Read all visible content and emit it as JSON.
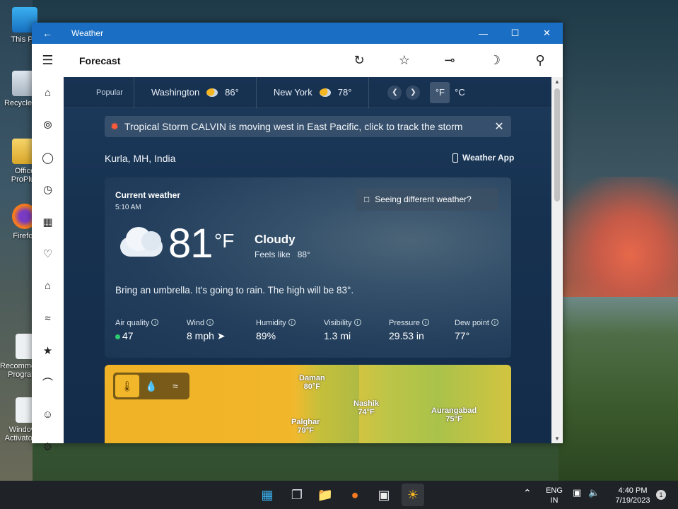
{
  "desktop": {
    "icons": [
      {
        "label": "This PC"
      },
      {
        "label": "Recycle Bin"
      },
      {
        "label": "Office ProPlus"
      },
      {
        "label": "Firefox"
      },
      {
        "label": "Recommended Programs"
      },
      {
        "label": "Windows Activator.txt"
      }
    ]
  },
  "window": {
    "title": "Weather",
    "back_icon": "back-arrow-icon",
    "controls": [
      "minimize",
      "maximize",
      "close"
    ]
  },
  "appbar": {
    "page_title": "Forecast",
    "tools": [
      "refresh-icon",
      "favorite-icon",
      "pin-icon",
      "dark-mode-icon",
      "search-icon"
    ]
  },
  "sidenav": [
    "home",
    "radar",
    "globe",
    "history",
    "calendar",
    "health",
    "building",
    "chart",
    "star-list",
    "more",
    "account",
    "settings"
  ],
  "citybar": {
    "popular_label": "Popular",
    "cities": [
      {
        "name": "Washington",
        "temp": "86°"
      },
      {
        "name": "New York",
        "temp": "78°"
      }
    ],
    "unit_f": "°F",
    "unit_c": "°C",
    "active_unit": "F"
  },
  "alert": {
    "text": "Tropical Storm CALVIN is moving west in East Pacific, click to track the storm"
  },
  "location": {
    "name": "Kurla, MH, India",
    "weather_app_label": "Weather App"
  },
  "current": {
    "heading": "Current weather",
    "time": "5:10 AM",
    "seeing_different": "Seeing different weather?",
    "temp": "81",
    "unit": "°F",
    "condition": "Cloudy",
    "feels_like_label": "Feels like",
    "feels_like_value": "88°",
    "summary": "Bring an umbrella. It's going to rain. The high will be 83°.",
    "stats": [
      {
        "label": "Air quality",
        "value": "47"
      },
      {
        "label": "Wind",
        "value": "8 mph"
      },
      {
        "label": "Humidity",
        "value": "89%"
      },
      {
        "label": "Visibility",
        "value": "1.3 mi"
      },
      {
        "label": "Pressure",
        "value": "29.53 in"
      },
      {
        "label": "Dew point",
        "value": "77°"
      }
    ]
  },
  "map": {
    "places": [
      {
        "name": "Daman",
        "temp": "80°F"
      },
      {
        "name": "Nashik",
        "temp": "74°F"
      },
      {
        "name": "Aurangabad",
        "temp": "75°F"
      },
      {
        "name": "Palghar",
        "temp": "79°F"
      }
    ]
  },
  "taskbar": {
    "lang_top": "ENG",
    "lang_bottom": "IN",
    "time": "4:40 PM",
    "date": "7/19/2023",
    "notification_count": "1"
  },
  "colors": {
    "titlebar": "#1a6fc4",
    "alert_storm": "#ff5a3a",
    "aqi_good": "#2ecc71"
  }
}
